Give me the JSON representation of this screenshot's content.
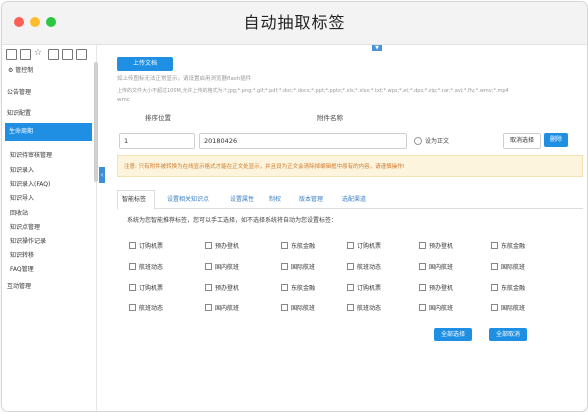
{
  "window": {
    "title": "自动抽取标签",
    "colors": {
      "close": "#fe5f57",
      "minimize": "#febc2e",
      "maximize": "#29c840",
      "accent": "#1e8fe3"
    }
  },
  "sidebar": {
    "tool_icons": [
      "file-icon",
      "edit-icon",
      "star-icon",
      "document-icon",
      "external-link-icon",
      "export-icon"
    ],
    "items": [
      {
        "label": "管控制"
      },
      {
        "label": "公告管理"
      },
      {
        "label": "知识配置"
      },
      {
        "label": "生命周期"
      }
    ],
    "sub_items": [
      "知识待审核管理",
      "知识录入",
      "知识录入(FAQ)",
      "知识导入",
      "回收站",
      "知识点管理",
      "知识操作记录",
      "知识转移",
      "FAQ管理"
    ],
    "bottom_item": "互动管理"
  },
  "upload": {
    "button_label": "上传文档",
    "hint_line1": "如上传图标无法正常显示，请设置启用浏览器flash插件",
    "hint_line2": "上传的文件大小不超过100M,允许上传的格式为:*.jpg;*.png;*.gif;*.pdf;*.doc;*.docx;*.ppt;*.pptx;*.xls;*.xlsx;*.txt;*.wps;*.et;*.dps;*.zip;*.rar;*.avi;*.flv;*.wmv;*.mp4",
    "hint_line3": "wmc"
  },
  "attachments": {
    "col_order": "排序位置",
    "col_name": "附件名称",
    "order_value": "1",
    "name_value": "20180426",
    "radio_label": "设为正文",
    "cancel_label": "取消选择",
    "delete_label": "删除"
  },
  "notice": "注意: 只有附件被转换为在线显示格式才能在正文处显示，并且设为正文会清除掉编辑框中原有的内容，请谨慎操作!",
  "tabs": [
    "智能标签",
    "设置相关知识点",
    "设置属性",
    "制权",
    "版本管理",
    "选配渠道"
  ],
  "tag_section": {
    "description": "系统为您智能推荐标签，您可以手工选择，如不选择系统将自动为您设置标签：",
    "rows": [
      [
        "订购机票",
        "预办登机",
        "东航金融",
        "订购机票",
        "预办登机",
        "东航金融"
      ],
      [
        "航班动态",
        "国内航班",
        "国际航班",
        "航班动态",
        "国内航班",
        "国际航班"
      ],
      [
        "订购机票",
        "预办登机",
        "东航金融",
        "订购机票",
        "预办登机",
        "东航金融"
      ],
      [
        "航班动态",
        "国内航班",
        "国际航班",
        "航班动态",
        "国内航班",
        "国际航班"
      ]
    ],
    "select_all_label": "全部选择",
    "cancel_all_label": "全部取消"
  }
}
